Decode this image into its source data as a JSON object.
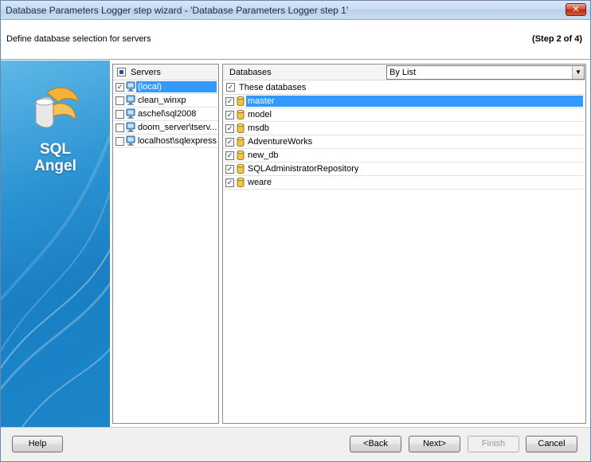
{
  "window": {
    "title": "Database Parameters Logger step wizard - 'Database Parameters Logger step 1'",
    "close_glyph": "✕"
  },
  "header": {
    "description": "Define database selection for servers",
    "step": "(Step 2 of 4)"
  },
  "banner": {
    "line1": "SQL",
    "line2": "Angel"
  },
  "servers": {
    "header": "Servers",
    "items": [
      {
        "label": "(local)",
        "checked": true,
        "selected": true
      },
      {
        "label": "clean_winxp",
        "checked": false,
        "selected": false
      },
      {
        "label": "aschel\\sql2008",
        "checked": false,
        "selected": false
      },
      {
        "label": "doom_server\\tserv...",
        "checked": false,
        "selected": false
      },
      {
        "label": "localhost\\sqlexpress",
        "checked": false,
        "selected": false
      }
    ]
  },
  "databases": {
    "header": "Databases",
    "mode": "By List",
    "select_all_label": "These databases",
    "items": [
      {
        "label": "master",
        "checked": true,
        "selected": true
      },
      {
        "label": "model",
        "checked": true,
        "selected": false
      },
      {
        "label": "msdb",
        "checked": true,
        "selected": false
      },
      {
        "label": "AdventureWorks",
        "checked": true,
        "selected": false
      },
      {
        "label": "new_db",
        "checked": true,
        "selected": false
      },
      {
        "label": "SQLAdministratorRepository",
        "checked": true,
        "selected": false
      },
      {
        "label": "weare",
        "checked": true,
        "selected": false
      }
    ]
  },
  "footer": {
    "help": "Help",
    "back": "<Back",
    "next": "Next>",
    "finish": "Finish",
    "cancel": "Cancel"
  },
  "colors": {
    "selection": "#3399ff",
    "banner": "#1a7fc4"
  }
}
